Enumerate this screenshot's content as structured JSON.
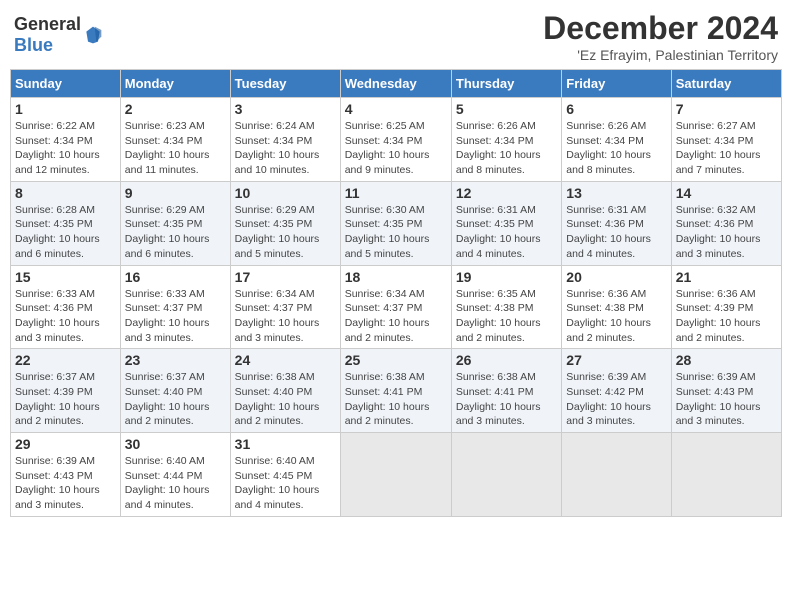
{
  "header": {
    "logo_general": "General",
    "logo_blue": "Blue",
    "month_title": "December 2024",
    "location": "'Ez Efrayim, Palestinian Territory"
  },
  "weekdays": [
    "Sunday",
    "Monday",
    "Tuesday",
    "Wednesday",
    "Thursday",
    "Friday",
    "Saturday"
  ],
  "weeks": [
    [
      {
        "day": "1",
        "sunrise": "6:22 AM",
        "sunset": "4:34 PM",
        "daylight": "10 hours and 12 minutes."
      },
      {
        "day": "2",
        "sunrise": "6:23 AM",
        "sunset": "4:34 PM",
        "daylight": "10 hours and 11 minutes."
      },
      {
        "day": "3",
        "sunrise": "6:24 AM",
        "sunset": "4:34 PM",
        "daylight": "10 hours and 10 minutes."
      },
      {
        "day": "4",
        "sunrise": "6:25 AM",
        "sunset": "4:34 PM",
        "daylight": "10 hours and 9 minutes."
      },
      {
        "day": "5",
        "sunrise": "6:26 AM",
        "sunset": "4:34 PM",
        "daylight": "10 hours and 8 minutes."
      },
      {
        "day": "6",
        "sunrise": "6:26 AM",
        "sunset": "4:34 PM",
        "daylight": "10 hours and 8 minutes."
      },
      {
        "day": "7",
        "sunrise": "6:27 AM",
        "sunset": "4:34 PM",
        "daylight": "10 hours and 7 minutes."
      }
    ],
    [
      {
        "day": "8",
        "sunrise": "6:28 AM",
        "sunset": "4:35 PM",
        "daylight": "10 hours and 6 minutes."
      },
      {
        "day": "9",
        "sunrise": "6:29 AM",
        "sunset": "4:35 PM",
        "daylight": "10 hours and 6 minutes."
      },
      {
        "day": "10",
        "sunrise": "6:29 AM",
        "sunset": "4:35 PM",
        "daylight": "10 hours and 5 minutes."
      },
      {
        "day": "11",
        "sunrise": "6:30 AM",
        "sunset": "4:35 PM",
        "daylight": "10 hours and 5 minutes."
      },
      {
        "day": "12",
        "sunrise": "6:31 AM",
        "sunset": "4:35 PM",
        "daylight": "10 hours and 4 minutes."
      },
      {
        "day": "13",
        "sunrise": "6:31 AM",
        "sunset": "4:36 PM",
        "daylight": "10 hours and 4 minutes."
      },
      {
        "day": "14",
        "sunrise": "6:32 AM",
        "sunset": "4:36 PM",
        "daylight": "10 hours and 3 minutes."
      }
    ],
    [
      {
        "day": "15",
        "sunrise": "6:33 AM",
        "sunset": "4:36 PM",
        "daylight": "10 hours and 3 minutes."
      },
      {
        "day": "16",
        "sunrise": "6:33 AM",
        "sunset": "4:37 PM",
        "daylight": "10 hours and 3 minutes."
      },
      {
        "day": "17",
        "sunrise": "6:34 AM",
        "sunset": "4:37 PM",
        "daylight": "10 hours and 3 minutes."
      },
      {
        "day": "18",
        "sunrise": "6:34 AM",
        "sunset": "4:37 PM",
        "daylight": "10 hours and 2 minutes."
      },
      {
        "day": "19",
        "sunrise": "6:35 AM",
        "sunset": "4:38 PM",
        "daylight": "10 hours and 2 minutes."
      },
      {
        "day": "20",
        "sunrise": "6:36 AM",
        "sunset": "4:38 PM",
        "daylight": "10 hours and 2 minutes."
      },
      {
        "day": "21",
        "sunrise": "6:36 AM",
        "sunset": "4:39 PM",
        "daylight": "10 hours and 2 minutes."
      }
    ],
    [
      {
        "day": "22",
        "sunrise": "6:37 AM",
        "sunset": "4:39 PM",
        "daylight": "10 hours and 2 minutes."
      },
      {
        "day": "23",
        "sunrise": "6:37 AM",
        "sunset": "4:40 PM",
        "daylight": "10 hours and 2 minutes."
      },
      {
        "day": "24",
        "sunrise": "6:38 AM",
        "sunset": "4:40 PM",
        "daylight": "10 hours and 2 minutes."
      },
      {
        "day": "25",
        "sunrise": "6:38 AM",
        "sunset": "4:41 PM",
        "daylight": "10 hours and 2 minutes."
      },
      {
        "day": "26",
        "sunrise": "6:38 AM",
        "sunset": "4:41 PM",
        "daylight": "10 hours and 3 minutes."
      },
      {
        "day": "27",
        "sunrise": "6:39 AM",
        "sunset": "4:42 PM",
        "daylight": "10 hours and 3 minutes."
      },
      {
        "day": "28",
        "sunrise": "6:39 AM",
        "sunset": "4:43 PM",
        "daylight": "10 hours and 3 minutes."
      }
    ],
    [
      {
        "day": "29",
        "sunrise": "6:39 AM",
        "sunset": "4:43 PM",
        "daylight": "10 hours and 3 minutes."
      },
      {
        "day": "30",
        "sunrise": "6:40 AM",
        "sunset": "4:44 PM",
        "daylight": "10 hours and 4 minutes."
      },
      {
        "day": "31",
        "sunrise": "6:40 AM",
        "sunset": "4:45 PM",
        "daylight": "10 hours and 4 minutes."
      },
      null,
      null,
      null,
      null
    ]
  ]
}
